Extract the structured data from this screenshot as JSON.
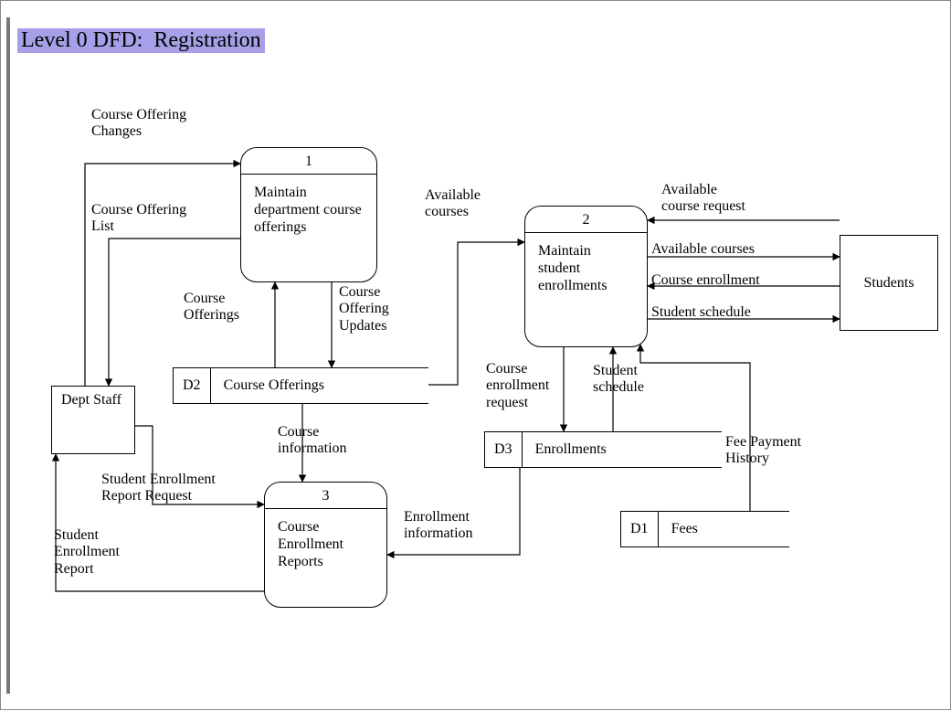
{
  "title": "Level 0 DFD:  Registration",
  "entities": {
    "dept_staff": "Dept\nStaff",
    "students": "Students"
  },
  "processes": {
    "p1": {
      "num": "1",
      "name": "Maintain\ndepartment\ncourse\nofferings"
    },
    "p2": {
      "num": "2",
      "name": "Maintain\nstudent\nenrollments"
    },
    "p3": {
      "num": "3",
      "name": "Course\nEnrollment\nReports"
    }
  },
  "datastores": {
    "d2": {
      "id": "D2",
      "name": "Course Offerings"
    },
    "d3": {
      "id": "D3",
      "name": "Enrollments"
    },
    "d1": {
      "id": "D1",
      "name": "Fees"
    }
  },
  "flows": {
    "course_offering_changes": "Course Offering\nChanges",
    "course_offering_list": "Course Offering\nList",
    "course_offerings": "Course\nOfferings",
    "course_offering_updates": "Course\nOffering\nUpdates",
    "available_courses": "Available\ncourses",
    "available_course_request": "Available\ncourse request",
    "available_courses2": "Available courses",
    "course_enrollment": "Course enrollment",
    "student_schedule": "Student schedule",
    "course_enrollment_request": "Course\nenrollment\nrequest",
    "student_schedule2": "Student\nschedule",
    "fee_payment_history": "Fee Payment\nHistory",
    "course_information": "Course\ninformation",
    "enrollment_information": "Enrollment\ninformation",
    "student_enrollment_report_request": "Student Enrollment\nReport Request",
    "student_enrollment_report": "Student\nEnrollment\nReport"
  }
}
